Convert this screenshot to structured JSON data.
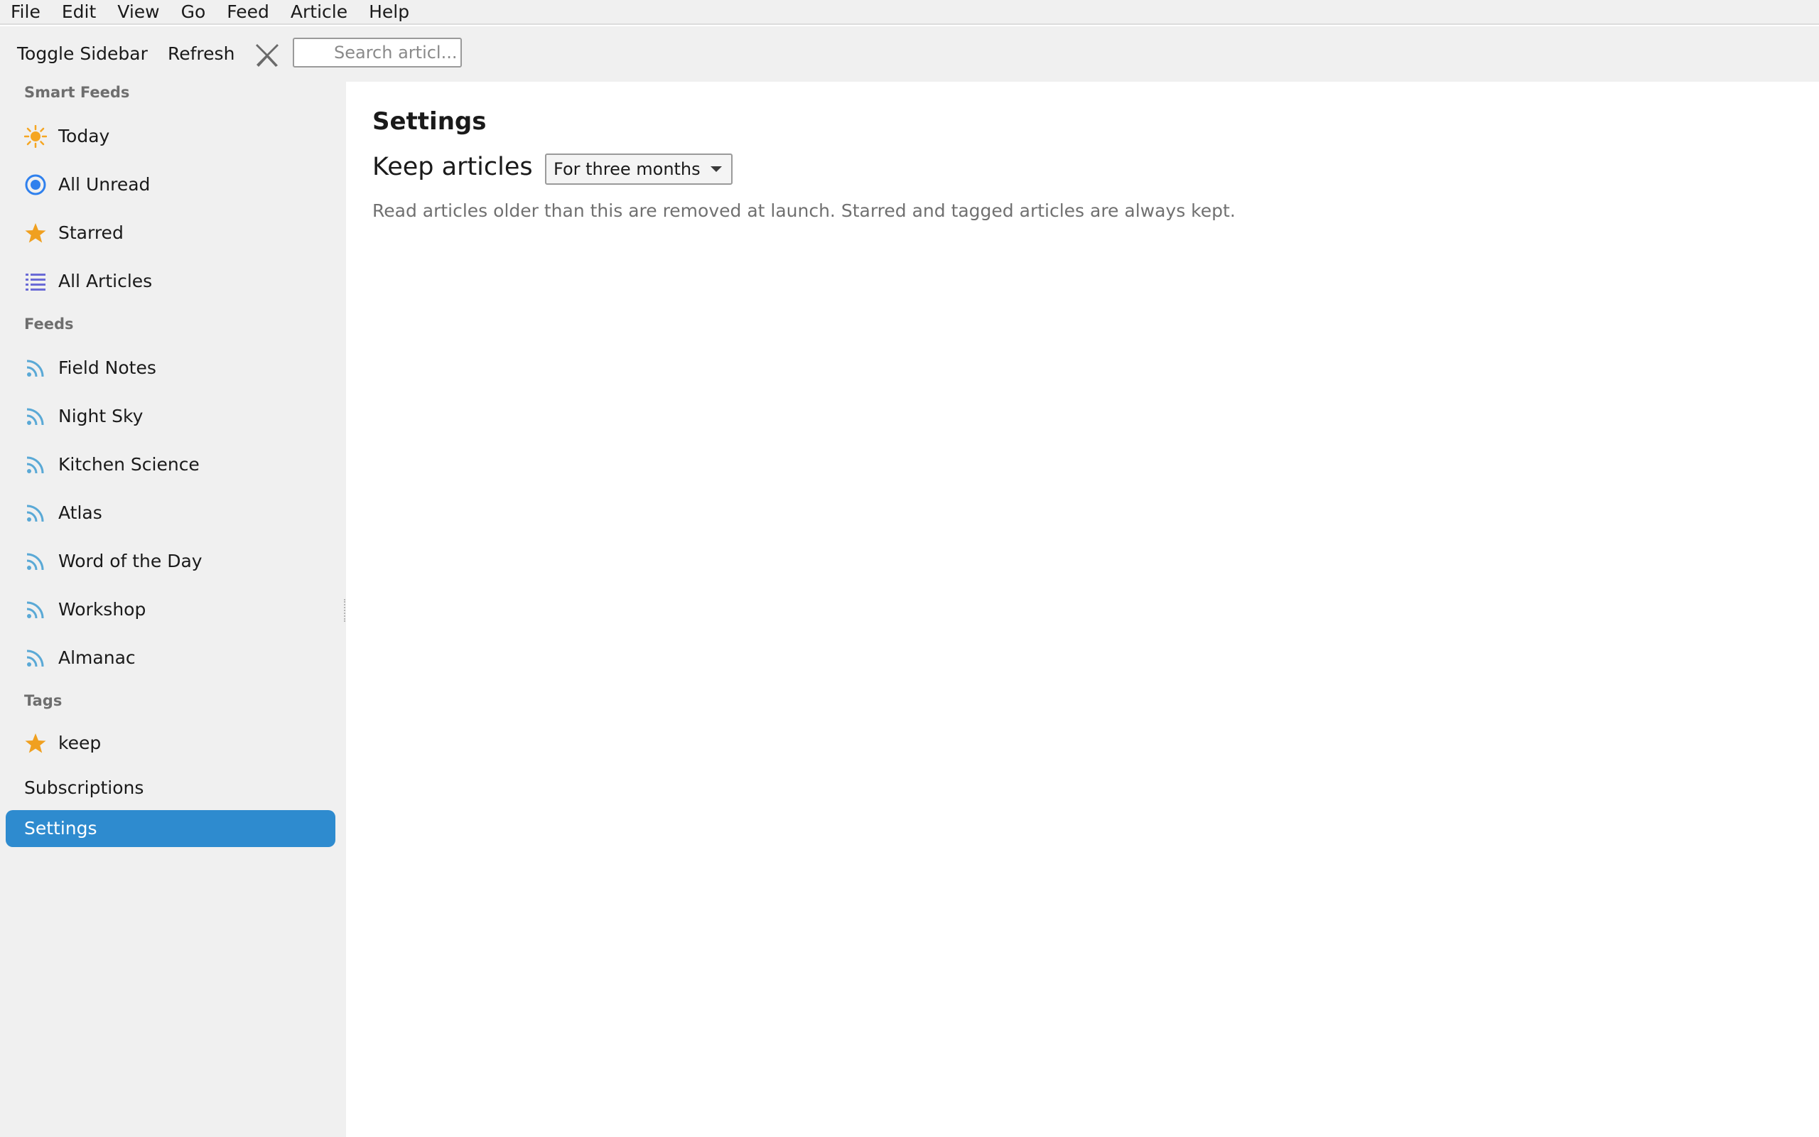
{
  "menubar": {
    "items": [
      "File",
      "Edit",
      "View",
      "Go",
      "Feed",
      "Article",
      "Help"
    ]
  },
  "toolbar": {
    "toggle_sidebar_label": "Toggle Sidebar",
    "refresh_label": "Refresh",
    "clear_icon": "close-x-icon",
    "search_placeholder": "Search articl..."
  },
  "sidebar": {
    "smart_feeds_header": "Smart Feeds",
    "smart_feeds": [
      {
        "label": "Today",
        "icon": "sun-icon"
      },
      {
        "label": "All Unread",
        "icon": "radio-dot-icon"
      },
      {
        "label": "Starred",
        "icon": "star-icon"
      },
      {
        "label": "All Articles",
        "icon": "list-icon"
      }
    ],
    "feeds_header": "Feeds",
    "feeds": [
      {
        "label": "Field Notes",
        "icon": "rss-icon"
      },
      {
        "label": "Night Sky",
        "icon": "rss-icon"
      },
      {
        "label": "Kitchen Science",
        "icon": "rss-icon"
      },
      {
        "label": "Atlas",
        "icon": "rss-icon"
      },
      {
        "label": "Word of the Day",
        "icon": "rss-icon"
      },
      {
        "label": "Workshop",
        "icon": "rss-icon"
      },
      {
        "label": "Almanac",
        "icon": "rss-icon"
      }
    ],
    "tags_header": "Tags",
    "tags": [
      {
        "label": "keep",
        "icon": "star-icon"
      }
    ],
    "subscriptions_label": "Subscriptions",
    "settings_label": "Settings",
    "active_item": "Settings"
  },
  "main": {
    "title": "Settings",
    "keep_articles_label": "Keep articles",
    "keep_articles_value": "For three months",
    "help_text": "Read articles older than this are removed at launch. Starred and tagged articles are always kept."
  },
  "colors": {
    "accent": "#2e8bcf",
    "sun": "#f5a623",
    "star": "#f0a020",
    "unread": "#2f80ed",
    "list": "#6b6bd6",
    "rss": "#5aa9d6",
    "sidebar_bg": "#f0f0f0"
  }
}
